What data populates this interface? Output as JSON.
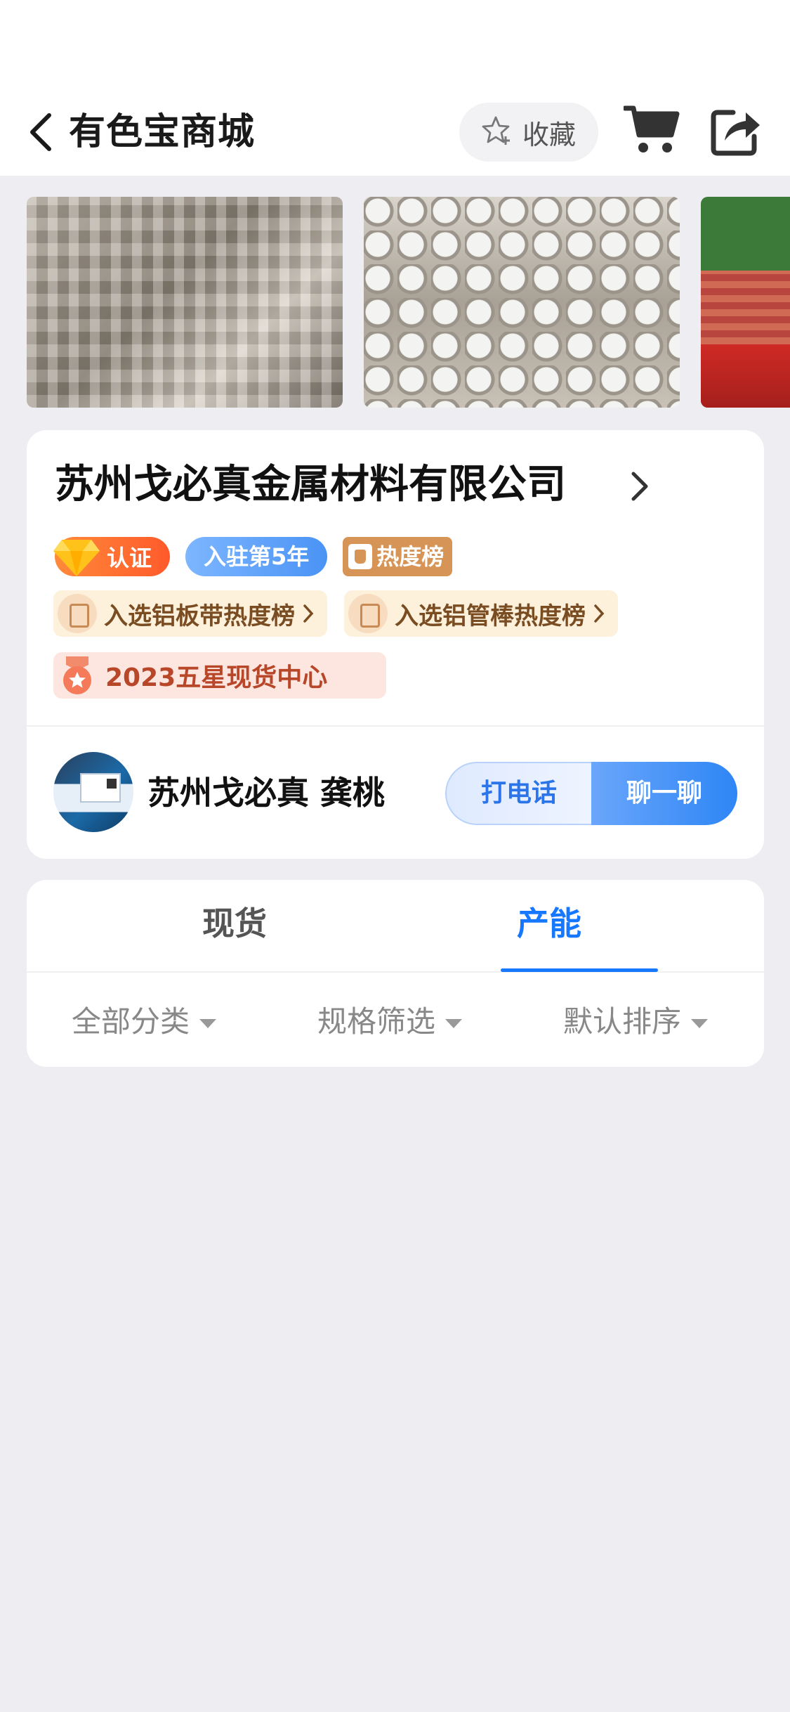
{
  "header": {
    "title": "有色宝商城",
    "favorite_label": "收藏"
  },
  "company": {
    "name": "苏州戈必真金属材料有限公司",
    "badges": {
      "cert": "认证",
      "years": "入驻第5年",
      "hot": "热度榜"
    },
    "rankings": [
      "入选铝板带热度榜",
      "入选铝管棒热度榜"
    ],
    "award": "2023五星现货中心",
    "contact": {
      "name": "苏州戈必真 龚桃",
      "call_label": "打电话",
      "chat_label": "聊一聊"
    }
  },
  "tabs": [
    {
      "label": "现货",
      "active": false
    },
    {
      "label": "产能",
      "active": true
    }
  ],
  "filters": [
    "全部分类",
    "规格筛选",
    "默认排序"
  ],
  "colors": {
    "accent": "#1677ff",
    "cert_orange": "#ff6a2a",
    "award_red": "#b8472a"
  }
}
